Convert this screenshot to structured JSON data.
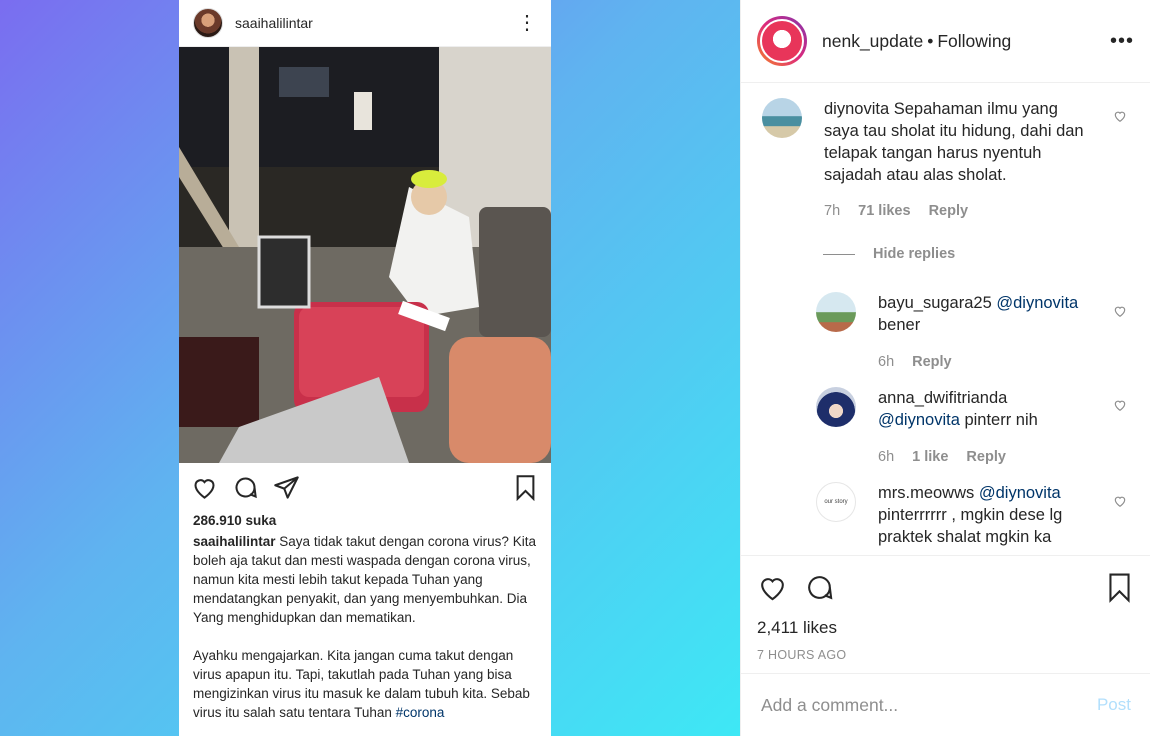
{
  "phone_post": {
    "username": "saaihalilintar",
    "likes": "286.910 suka",
    "caption_user": "saaihalilintar",
    "caption_p1": " Saya tidak takut dengan corona virus? Kita boleh aja takut dan mesti waspada dengan corona virus, namun kita mesti lebih takut kepada Tuhan yang mendatangkan penyakit, dan yang menyembuhkan. Dia Yang menghidupkan dan mematikan.",
    "caption_p2": "Ayahku mengajarkan. Kita jangan cuma takut dengan virus apapun itu. Tapi, takutlah pada Tuhan yang bisa mengizinkan virus itu masuk ke dalam tubuh kita. Sebab virus itu salah satu tentara Tuhan ",
    "caption_tag": "#corona"
  },
  "header": {
    "username": "nenk_update",
    "separator": "•",
    "follow_status": "Following"
  },
  "comments": [
    {
      "username": "diynovita",
      "text": " Sepahaman ilmu yang saya tau sholat itu hidung, dahi dan telapak tangan harus nyentuh sajadah atau alas sholat.",
      "time": "7h",
      "likes": "71 likes",
      "reply": "Reply"
    }
  ],
  "hide_replies": "Hide replies",
  "replies": [
    {
      "username": "bayu_sugara25",
      "mention": "@diynovita",
      "text": "bener",
      "time": "6h",
      "likes": "",
      "reply": "Reply"
    },
    {
      "username": "anna_dwifitrianda",
      "mention": "@diynovita",
      "text": " pinterr nih",
      "time": "6h",
      "likes": "1 like",
      "reply": "Reply"
    },
    {
      "username": "mrs.meowws",
      "mention": "@diynovita",
      "text": "pinterrrrrr , mgkin dese lg praktek shalat mgkin ka",
      "avatar_text": "our story"
    }
  ],
  "footer": {
    "likes": "2,411 likes",
    "time": "7 HOURS AGO",
    "comment_placeholder": "Add a comment...",
    "post_label": "Post"
  }
}
